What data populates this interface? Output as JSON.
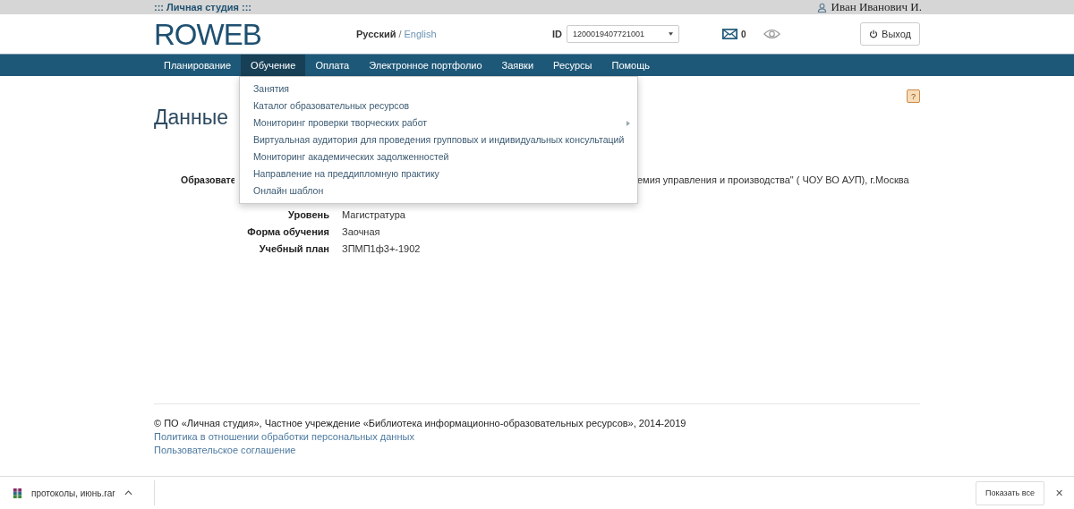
{
  "topbar": {
    "title": "::: Личная студия :::",
    "user": "Иван Иванович И."
  },
  "header": {
    "logo": "ROWEB",
    "lang_current": "Русский",
    "lang_sep": "/",
    "lang_other": "English",
    "id_label": "ID",
    "id_value": "1200019407721001",
    "mail_count": "0",
    "logout": "Выход"
  },
  "nav": [
    {
      "label": "Планирование",
      "selected": false
    },
    {
      "label": "Обучение",
      "selected": true
    },
    {
      "label": "Оплата",
      "selected": false
    },
    {
      "label": "Электронное портфолио",
      "selected": false
    },
    {
      "label": "Заявки",
      "selected": false
    },
    {
      "label": "Ресурсы",
      "selected": false
    },
    {
      "label": "Помощь",
      "selected": false
    }
  ],
  "dropdown": [
    {
      "label": "Занятия",
      "submenu": false
    },
    {
      "label": "Каталог образовательных ресурсов",
      "submenu": false
    },
    {
      "label": "Мониторинг проверки творческих работ",
      "submenu": true
    },
    {
      "label": "Виртуальная аудитория для проведения групповых и индивидуальных консультаций",
      "submenu": false
    },
    {
      "label": "Мониторинг академических задолженностей",
      "submenu": false
    },
    {
      "label": "Направление на преддипломную практику",
      "submenu": false
    },
    {
      "label": "Онлайн шаблон",
      "submenu": false
    }
  ],
  "help": "?",
  "page_title": "Данные",
  "fields": [
    {
      "kind": "covered",
      "label": "Образовате",
      "value": "емия управления и производства\" ( ЧОУ ВО АУП), г.Москва"
    },
    {
      "kind": "full",
      "label": "Уровень",
      "value": "Магистратура"
    },
    {
      "kind": "full",
      "label": "Форма обучения",
      "value": "Заочная"
    },
    {
      "kind": "full",
      "label": "Учебный план",
      "value": "ЗПМП1ф3+-1902"
    }
  ],
  "footer": {
    "copyright": "© ПО «Личная студия», Частное учреждение «Библиотека информационно-образовательных ресурсов», 2014-2019",
    "links": [
      "Политика в отношении обработки персональных данных",
      "Пользовательское соглашение"
    ]
  },
  "downloads": {
    "file": "протоколы, июнь.rar",
    "show_all": "Показать все",
    "close": "✕"
  }
}
